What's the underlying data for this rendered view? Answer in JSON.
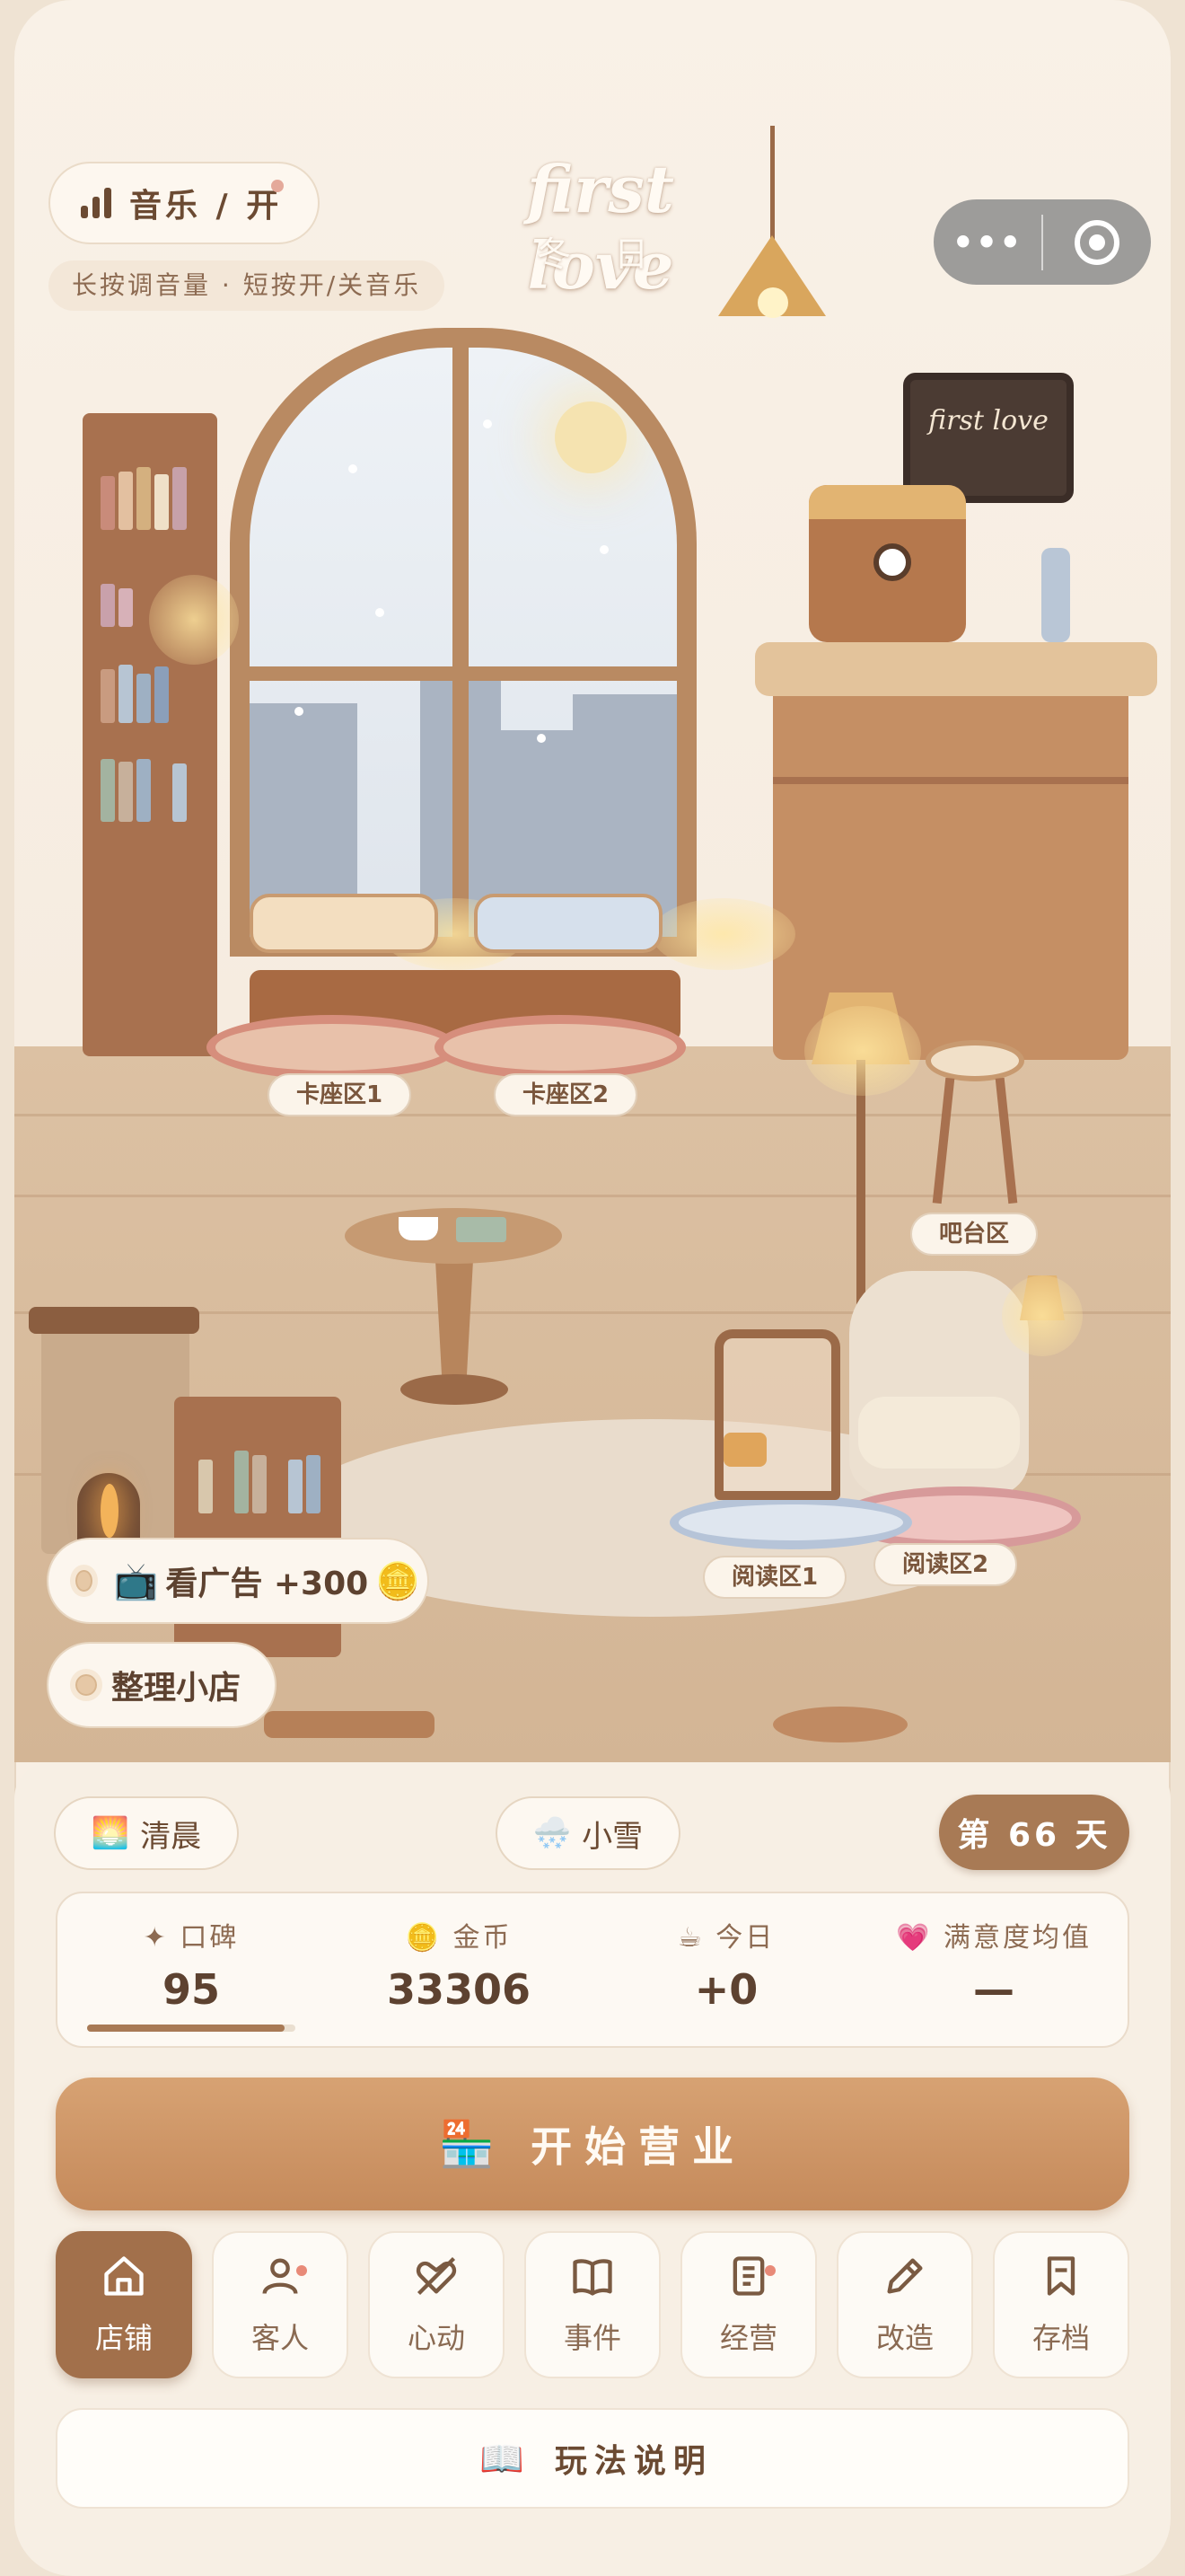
{
  "header": {
    "title": "first love",
    "season": "冬 日",
    "music_label": "音乐 / 开",
    "music_hint": "长按调音量 · 短按开/关音乐",
    "menu_dots": "•••"
  },
  "scene": {
    "board_text": "first love",
    "zones": [
      {
        "label": "卡座区1"
      },
      {
        "label": "卡座区2"
      },
      {
        "label": "吧台区"
      },
      {
        "label": "阅读区1"
      },
      {
        "label": "阅读区2"
      }
    ],
    "ad_button": {
      "icon": "📺",
      "label": "看广告 +300",
      "coin_icon": "🪙"
    },
    "tidy_button": {
      "label": "整理小店"
    }
  },
  "status": {
    "time_icon": "🌅",
    "time": "清晨",
    "weather_icon": "🌨️",
    "weather": "小雪",
    "day": "第 66 天"
  },
  "stats": [
    {
      "label": "✦ 口碑",
      "value": "95"
    },
    {
      "icon": "🪙",
      "label": "金币",
      "value": "33306"
    },
    {
      "icon": "☕",
      "label": "今日",
      "value": "+0"
    },
    {
      "icon": "💗",
      "label": "满意度均值",
      "value": "—"
    }
  ],
  "reputation_fraction": 0.95,
  "open_button": {
    "icon": "🏪",
    "label": "开始营业"
  },
  "nav": [
    {
      "label": "店铺",
      "icon": "home-icon",
      "active": true
    },
    {
      "label": "客人",
      "icon": "person-icon",
      "badge": true
    },
    {
      "label": "心动",
      "icon": "heart-arrow-icon"
    },
    {
      "label": "事件",
      "icon": "book-icon"
    },
    {
      "label": "经营",
      "icon": "ledger-icon",
      "badge": true
    },
    {
      "label": "改造",
      "icon": "pencil-icon"
    },
    {
      "label": "存档",
      "icon": "bookmark-icon"
    }
  ],
  "guide": {
    "icon": "📖",
    "label": "玩法说明"
  },
  "colors": {
    "accent": "#a87a55",
    "button": "#c58a5b",
    "background": "#f8efe4"
  }
}
